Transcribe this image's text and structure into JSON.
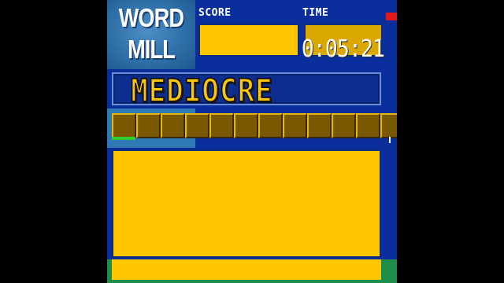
{
  "logo": {
    "line1": "WORD",
    "line2": "MILL"
  },
  "header": {
    "score_label": "SCORE",
    "time_label": "TIME",
    "time_value": "0:05:21"
  },
  "word": {
    "current": "MEDIOCRE"
  },
  "tiles": {
    "count": 12
  },
  "colors": {
    "background": "#0a2f9c",
    "accent": "#ffc700",
    "tile": "#7a5800",
    "progress": "#2fcf2f",
    "marker": "#e01a1a"
  }
}
